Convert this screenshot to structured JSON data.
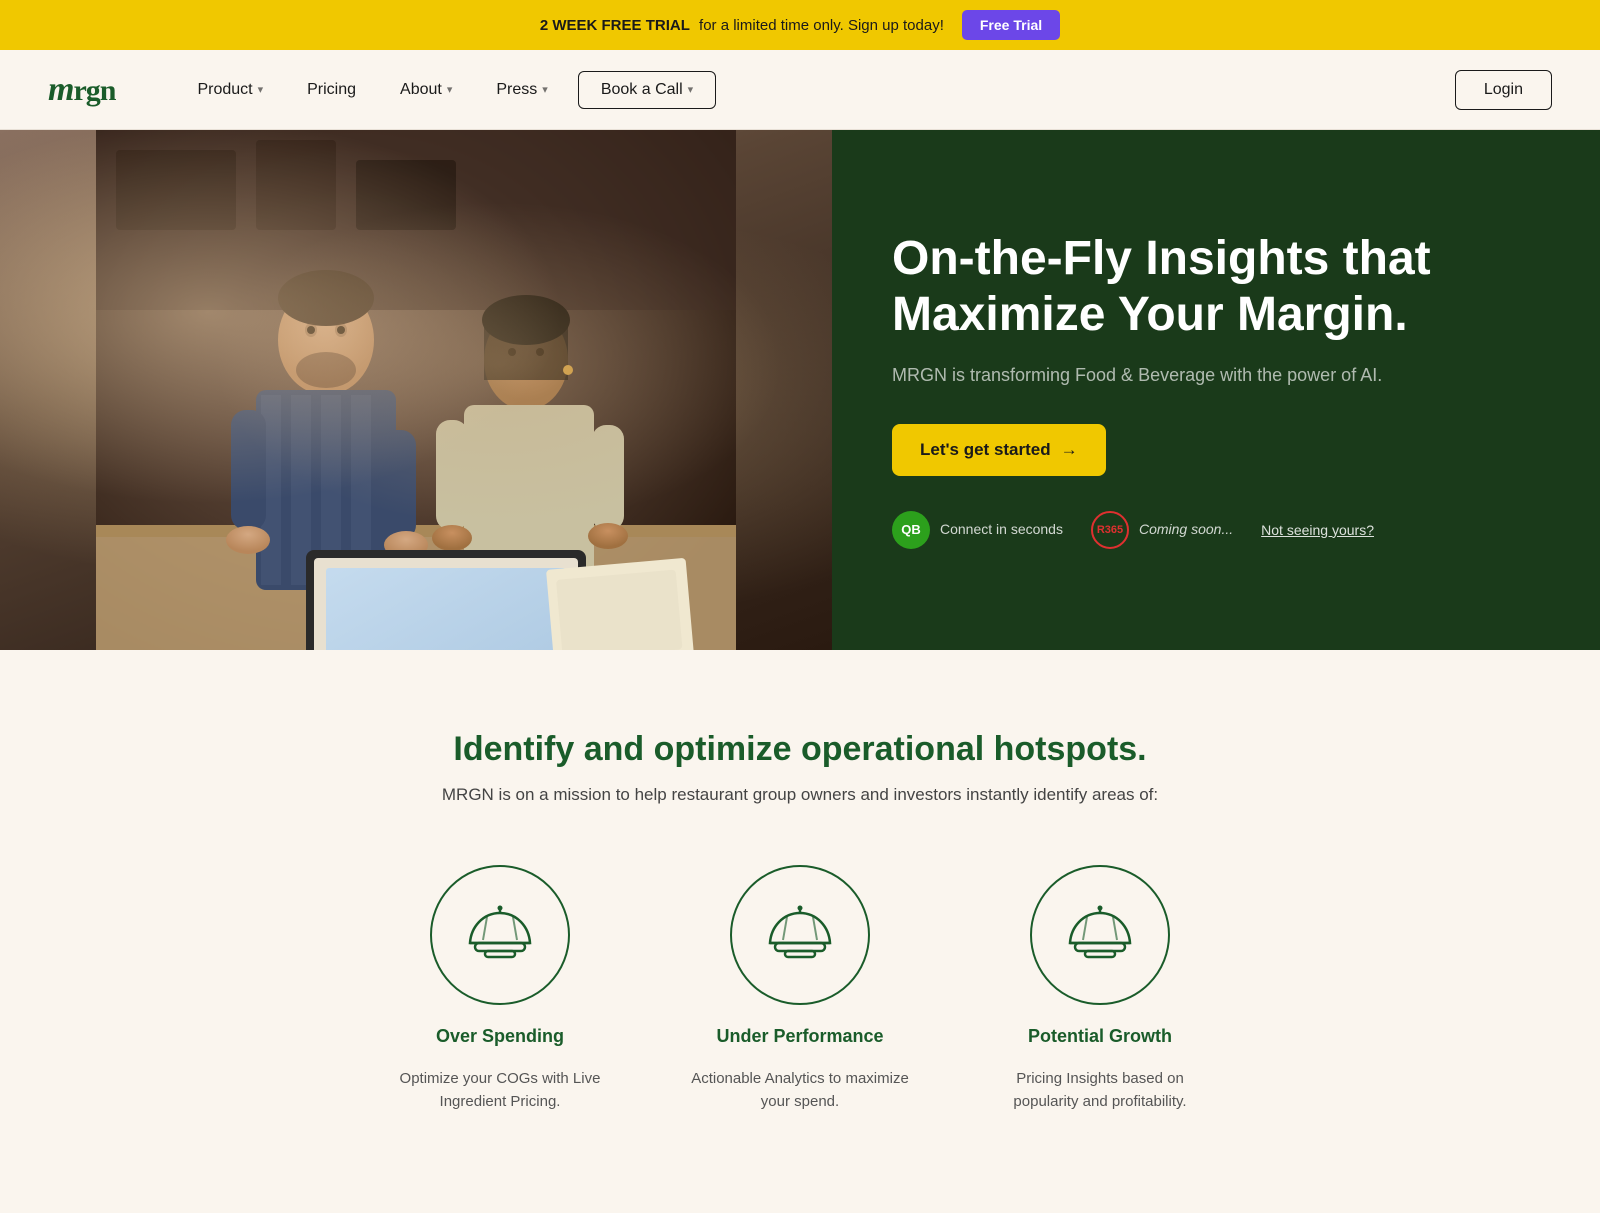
{
  "banner": {
    "text_bold": "2 WEEK FREE TRIAL",
    "text_normal": "for a limited time only. Sign up today!",
    "button_label": "Free Trial"
  },
  "navbar": {
    "logo": "mrgn",
    "links": [
      {
        "label": "Product",
        "has_dropdown": true
      },
      {
        "label": "Pricing",
        "has_dropdown": false
      },
      {
        "label": "About",
        "has_dropdown": true
      },
      {
        "label": "Press",
        "has_dropdown": true
      },
      {
        "label": "Book a Call",
        "has_dropdown": true
      }
    ],
    "login_label": "Login"
  },
  "hero": {
    "title": "On-the-Fly Insights that Maximize Your Margin.",
    "subtitle": "MRGN is transforming Food & Beverage with the power of AI.",
    "cta_label": "Let's get started",
    "cta_arrow": "→",
    "integration_qb_label": "Connect in seconds",
    "integration_r365_label": "Coming soon...",
    "not_seeing_label": "Not seeing yours?"
  },
  "hotspots": {
    "heading": "Identify and optimize operational hotspots.",
    "subtext": "MRGN is on a mission to help restaurant group owners and investors instantly identify areas of:",
    "cards": [
      {
        "label": "Over Spending",
        "desc": "Optimize your COGs with Live Ingredient Pricing."
      },
      {
        "label": "Under Performance",
        "desc": "Actionable Analytics to maximize your spend."
      },
      {
        "label": "Potential Growth",
        "desc": "Pricing Insights based on popularity and profitability."
      }
    ]
  }
}
